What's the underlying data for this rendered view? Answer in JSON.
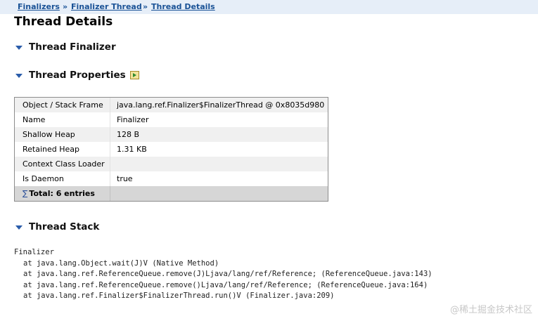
{
  "breadcrumb": {
    "items": [
      "Finalizers",
      "Finalizer Thread",
      "Thread Details"
    ],
    "separator": "»"
  },
  "page_title": "Thread Details",
  "sections": {
    "finalizer": "Thread Finalizer",
    "properties": "Thread Properties",
    "stack": "Thread Stack"
  },
  "properties_table": {
    "rows": [
      {
        "key": "Object / Stack Frame",
        "value": "java.lang.ref.Finalizer$FinalizerThread @ 0x8035d980"
      },
      {
        "key": "Name",
        "value": "Finalizer"
      },
      {
        "key": "Shallow Heap",
        "value": "128 B"
      },
      {
        "key": "Retained Heap",
        "value": "1.31 KB"
      },
      {
        "key": "Context Class Loader",
        "value": ""
      },
      {
        "key": "Is Daemon",
        "value": "true"
      }
    ],
    "total_symbol": "∑",
    "total_label": "Total: 6 entries"
  },
  "thread_stack": {
    "thread_name": "Finalizer",
    "frames": [
      "at java.lang.Object.wait(J)V (Native Method)",
      "at java.lang.ref.ReferenceQueue.remove(J)Ljava/lang/ref/Reference; (ReferenceQueue.java:143)",
      "at java.lang.ref.ReferenceQueue.remove()Ljava/lang/ref/Reference; (ReferenceQueue.java:164)",
      "at java.lang.ref.Finalizer$FinalizerThread.run()V (Finalizer.java:209)"
    ]
  },
  "watermark": "@稀土掘金技术社区",
  "colors": {
    "link": "#1a5296",
    "breadcrumb_bg": "#e6eef8",
    "triangle": "#2a5caa"
  },
  "icons": {
    "section_toggle": "triangle-down-icon",
    "export": "export-icon",
    "total": "sigma-icon"
  }
}
